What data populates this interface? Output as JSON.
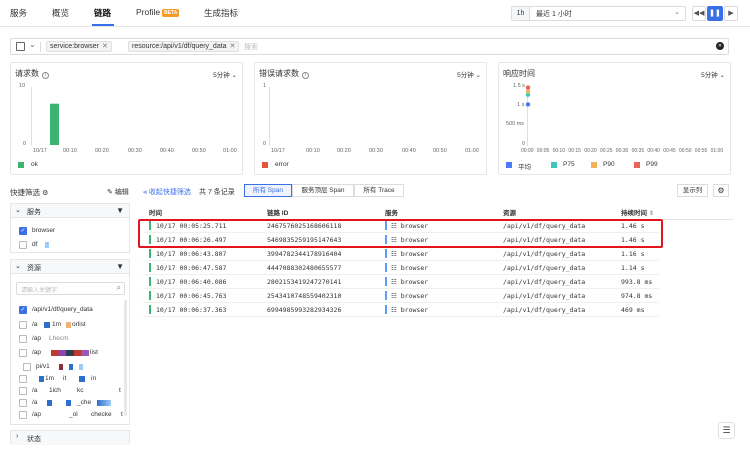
{
  "tabs": [
    {
      "label": "服务"
    },
    {
      "label": "概览"
    },
    {
      "label": "链路"
    },
    {
      "label": "Profile"
    },
    {
      "label": "生成指标"
    }
  ],
  "profile_badge": "BETA",
  "time": {
    "quick": "1h",
    "range": "最近 1 小时"
  },
  "filter": {
    "chips": [
      "service:browser",
      "resource:/api/v1/df/query_data"
    ],
    "placeholder": "搜索"
  },
  "charts": {
    "requests": {
      "title": "请求数",
      "interval": "5分钟",
      "y_ticks": [
        "10",
        "0"
      ],
      "x_ticks": [
        "10/17",
        "00:10",
        "00:20",
        "00:30",
        "00:40",
        "00:50",
        "01:00"
      ],
      "legend": "ok"
    },
    "errors": {
      "title": "错误请求数",
      "interval": "5分钟",
      "y_ticks": [
        "1",
        "0"
      ],
      "x_ticks": [
        "10/17",
        "00:10",
        "00:20",
        "00:30",
        "00:40",
        "00:50",
        "01:00"
      ],
      "legend": "error"
    },
    "latency": {
      "title": "响应时间",
      "interval": "5分钟",
      "y_ticks": [
        "1.5 s",
        "1 s",
        "500 ms",
        "0"
      ],
      "x_ticks": [
        "00:00",
        "00:05",
        "00:10",
        "00:15",
        "00:20",
        "00:25",
        "00:30",
        "00:35",
        "00:40",
        "00:45",
        "00:50",
        "00:55",
        "01:00"
      ],
      "legend": [
        "平均",
        "P75",
        "P90",
        "P99"
      ]
    }
  },
  "chart_data": [
    {
      "type": "bar",
      "title": "请求数",
      "x": [
        "10/17 00:05",
        "10/17 00:10",
        "10/17 00:15",
        "10/17 00:20",
        "10/17 00:25",
        "10/17 00:30",
        "10/17 00:35",
        "10/17 00:40",
        "10/17 00:45",
        "10/17 00:50",
        "10/17 00:55",
        "10/17 01:00"
      ],
      "series": [
        {
          "name": "ok",
          "values": [
            7,
            0,
            0,
            0,
            0,
            0,
            0,
            0,
            0,
            0,
            0,
            0
          ]
        }
      ],
      "ylim": [
        0,
        10
      ],
      "legend": "bottom-left",
      "grid": false,
      "colors": {
        "ok": "#3cb371"
      }
    },
    {
      "type": "bar",
      "title": "错误请求数",
      "x": [
        "10/17 00:05",
        "10/17 00:10",
        "10/17 00:15",
        "10/17 00:20",
        "10/17 00:25",
        "10/17 00:30",
        "10/17 00:35",
        "10/17 00:40",
        "10/17 00:45",
        "10/17 00:50",
        "10/17 00:55",
        "10/17 01:00"
      ],
      "series": [
        {
          "name": "error",
          "values": [
            0,
            0,
            0,
            0,
            0,
            0,
            0,
            0,
            0,
            0,
            0,
            0
          ]
        }
      ],
      "ylim": [
        0,
        1
      ],
      "legend": "bottom-left",
      "grid": false,
      "colors": {
        "error": "#e8533c"
      }
    },
    {
      "type": "scatter",
      "title": "响应时间",
      "x": [
        "00:05"
      ],
      "series": [
        {
          "name": "平均",
          "values": [
            1.03
          ]
        },
        {
          "name": "P75",
          "values": [
            1.28
          ]
        },
        {
          "name": "P90",
          "values": [
            1.36
          ]
        },
        {
          "name": "P99",
          "values": [
            1.46
          ]
        }
      ],
      "ylim": [
        0,
        1.5
      ],
      "yunit": "s",
      "legend": "bottom",
      "grid": false,
      "colors": {
        "平均": "#4a7bf7",
        "P75": "#3cc7b9",
        "P90": "#f2b15b",
        "P99": "#e8645a"
      }
    }
  ],
  "sidebar": {
    "title": "快捷筛选",
    "edit": "编辑",
    "collapse": "收起快捷筛选",
    "service_section": {
      "title": "服务",
      "options": [
        "browser",
        "df"
      ]
    },
    "resource_section": {
      "title": "资源",
      "search_placeholder": "请输入关键字",
      "options": [
        "/api/v1/df/query_data",
        "/a",
        "/ap",
        "/ap",
        "pi/v1",
        "/a",
        "/a",
        "/ap",
        "/api/v"
      ],
      "fragments": [
        "1m",
        "orlist",
        "Lhecm",
        "list",
        "it",
        "in",
        "1ich",
        "kc",
        "t",
        "_che",
        "_ol",
        "checke",
        "t"
      ]
    },
    "status_section": {
      "title": "状态"
    }
  },
  "table": {
    "count": "共 7 条记录",
    "segments": [
      "所有 Span",
      "服务顶层 Span",
      "所有 Trace"
    ],
    "display_cols": "显示列",
    "headers": [
      "时间",
      "链路 ID",
      "服务",
      "资源",
      "持续时间"
    ],
    "rows": [
      {
        "time": "10/17 00:05:25.711",
        "id": "2467576025168606118",
        "service": "browser",
        "resource": "/api/v1/df/query_data",
        "duration": "1.46 s"
      },
      {
        "time": "10/17 00:06:26.497",
        "id": "5469835259195147643",
        "service": "browser",
        "resource": "/api/v1/df/query_data",
        "duration": "1.46 s"
      },
      {
        "time": "10/17 00:06:43.807",
        "id": "3994782344178916404",
        "service": "browser",
        "resource": "/api/v1/df/query_data",
        "duration": "1.16 s"
      },
      {
        "time": "10/17 00:06:47.587",
        "id": "4447088302480655577",
        "service": "browser",
        "resource": "/api/v1/df/query_data",
        "duration": "1.14 s"
      },
      {
        "time": "10/17 00:06:40.086",
        "id": "2802153419247270141",
        "service": "browser",
        "resource": "/api/v1/df/query_data",
        "duration": "993.8 ms"
      },
      {
        "time": "10/17 00:06:45.763",
        "id": "2543410748559402310",
        "service": "browser",
        "resource": "/api/v1/df/query_data",
        "duration": "974.8 ms"
      },
      {
        "time": "10/17 00:06:37.363",
        "id": "6994985993282934326",
        "service": "browser",
        "resource": "/api/v1/df/query_data",
        "duration": "469 ms"
      }
    ]
  }
}
